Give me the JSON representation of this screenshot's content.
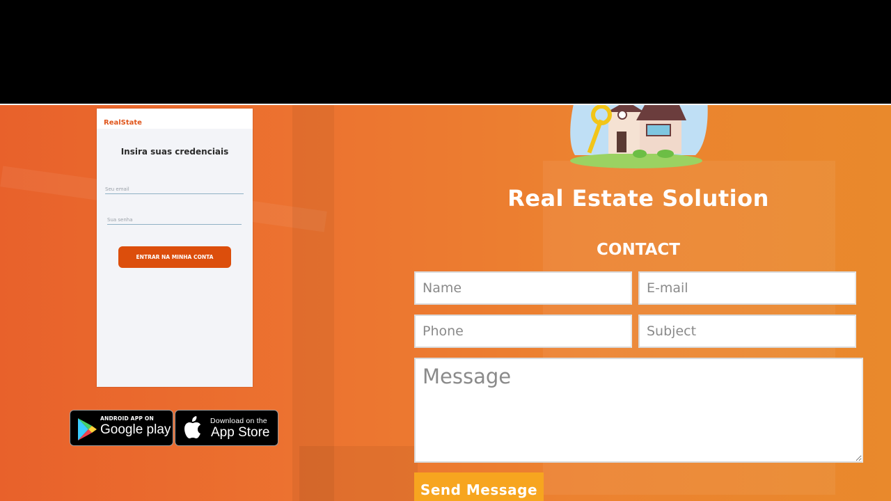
{
  "app": {
    "phone": {
      "brand": "RealState",
      "title": "Insira suas credenciais",
      "email_placeholder": "Seu email",
      "password_placeholder": "Sua senha",
      "login_button": "ENTRAR NA MINHA CONTA"
    },
    "google_play": {
      "small": "ANDROID APP ON",
      "big": "Google play"
    },
    "app_store": {
      "small": "Download on the",
      "big": "App Store"
    }
  },
  "brand": {
    "title": "Real Estate Solution"
  },
  "contact": {
    "title": "CONTACT",
    "name_placeholder": "Name",
    "email_placeholder": "E-mail",
    "phone_placeholder": "Phone",
    "subject_placeholder": "Subject",
    "message_placeholder": "Message",
    "send_label": "Send Message"
  },
  "colors": {
    "background_orange": "#ec7330",
    "button_orange": "#dc4e0c",
    "send_button": "#f7a51f"
  }
}
